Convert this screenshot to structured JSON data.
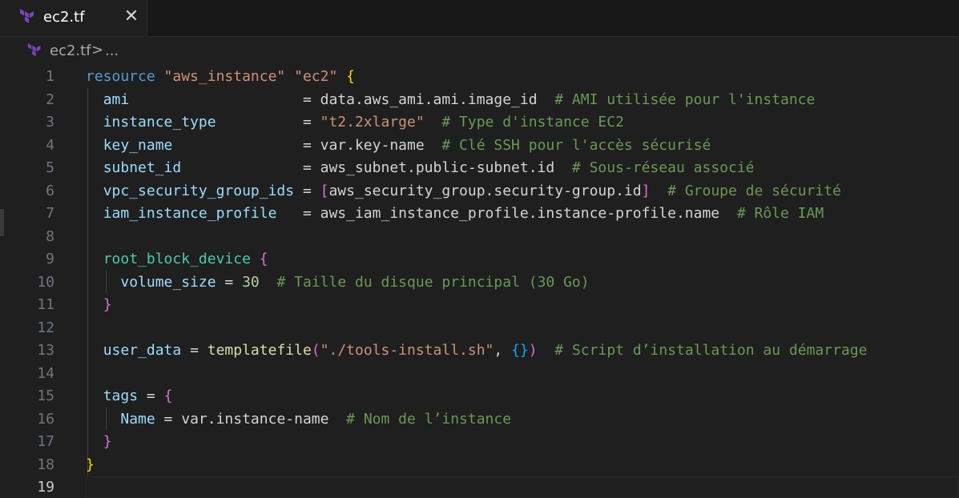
{
  "tab": {
    "label": "ec2.tf",
    "close_glyph": "✕"
  },
  "breadcrumb": {
    "file": "ec2.tf",
    "separator": ">",
    "more": "..."
  },
  "editor": {
    "active_line": 19,
    "lines": [
      {
        "n": "1",
        "tokens": [
          [
            "kw",
            "resource"
          ],
          [
            "op",
            " "
          ],
          [
            "str",
            "\"aws_instance\""
          ],
          [
            "op",
            " "
          ],
          [
            "str",
            "\"ec2\""
          ],
          [
            "op",
            " "
          ],
          [
            "brace-y",
            "{"
          ]
        ]
      },
      {
        "n": "2",
        "tokens": [
          [
            "op",
            "  "
          ],
          [
            "attr",
            "ami"
          ],
          [
            "op",
            "                    = "
          ],
          [
            "op",
            "data.aws_ami.ami.image_id"
          ],
          [
            "op",
            "  "
          ],
          [
            "cmt",
            "# AMI utilisée pour l'instance"
          ]
        ]
      },
      {
        "n": "3",
        "tokens": [
          [
            "op",
            "  "
          ],
          [
            "attr",
            "instance_type"
          ],
          [
            "op",
            "          = "
          ],
          [
            "str",
            "\"t2.2xlarge\""
          ],
          [
            "op",
            "  "
          ],
          [
            "cmt",
            "# Type d'instance EC2"
          ]
        ]
      },
      {
        "n": "4",
        "tokens": [
          [
            "op",
            "  "
          ],
          [
            "attr",
            "key_name"
          ],
          [
            "op",
            "               = "
          ],
          [
            "op",
            "var.key-name"
          ],
          [
            "op",
            "  "
          ],
          [
            "cmt",
            "# Clé SSH pour l'accès sécurisé"
          ]
        ]
      },
      {
        "n": "5",
        "tokens": [
          [
            "op",
            "  "
          ],
          [
            "attr",
            "subnet_id"
          ],
          [
            "op",
            "              = "
          ],
          [
            "op",
            "aws_subnet.public-subnet.id"
          ],
          [
            "op",
            "  "
          ],
          [
            "cmt",
            "# Sous-réseau associé"
          ]
        ]
      },
      {
        "n": "6",
        "tokens": [
          [
            "op",
            "  "
          ],
          [
            "attr",
            "vpc_security_group_ids"
          ],
          [
            "op",
            " = "
          ],
          [
            "brace-p",
            "["
          ],
          [
            "op",
            "aws_security_group.security-group.id"
          ],
          [
            "brace-p",
            "]"
          ],
          [
            "op",
            "  "
          ],
          [
            "cmt",
            "# Groupe de sécurité"
          ]
        ]
      },
      {
        "n": "7",
        "tokens": [
          [
            "op",
            "  "
          ],
          [
            "attr",
            "iam_instance_profile"
          ],
          [
            "op",
            "   = "
          ],
          [
            "op",
            "aws_iam_instance_profile.instance-profile.name"
          ],
          [
            "op",
            "  "
          ],
          [
            "cmt",
            "# Rôle IAM"
          ]
        ]
      },
      {
        "n": "8",
        "tokens": []
      },
      {
        "n": "9",
        "tokens": [
          [
            "op",
            "  "
          ],
          [
            "blk",
            "root_block_device"
          ],
          [
            "op",
            " "
          ],
          [
            "brace-p",
            "{"
          ]
        ]
      },
      {
        "n": "10",
        "tokens": [
          [
            "op",
            "    "
          ],
          [
            "attr",
            "volume_size"
          ],
          [
            "op",
            " = "
          ],
          [
            "num",
            "30"
          ],
          [
            "op",
            "  "
          ],
          [
            "cmt",
            "# Taille du disque principal (30 Go)"
          ]
        ]
      },
      {
        "n": "11",
        "tokens": [
          [
            "op",
            "  "
          ],
          [
            "brace-p",
            "}"
          ]
        ]
      },
      {
        "n": "12",
        "tokens": []
      },
      {
        "n": "13",
        "tokens": [
          [
            "op",
            "  "
          ],
          [
            "attr",
            "user_data"
          ],
          [
            "op",
            " = "
          ],
          [
            "fn",
            "templatefile"
          ],
          [
            "brace-p",
            "("
          ],
          [
            "str",
            "\"./tools-install.sh\""
          ],
          [
            "op",
            ", "
          ],
          [
            "brace-b",
            "{}"
          ],
          [
            "brace-p",
            ")"
          ],
          [
            "op",
            "  "
          ],
          [
            "cmt",
            "# Script d’installation au démarrage"
          ]
        ]
      },
      {
        "n": "14",
        "tokens": []
      },
      {
        "n": "15",
        "tokens": [
          [
            "op",
            "  "
          ],
          [
            "attr",
            "tags"
          ],
          [
            "op",
            " = "
          ],
          [
            "brace-p",
            "{"
          ]
        ]
      },
      {
        "n": "16",
        "tokens": [
          [
            "op",
            "    "
          ],
          [
            "attr",
            "Name"
          ],
          [
            "op",
            " = "
          ],
          [
            "op",
            "var.instance-name"
          ],
          [
            "op",
            "  "
          ],
          [
            "cmt",
            "# Nom de l’instance"
          ]
        ]
      },
      {
        "n": "17",
        "tokens": [
          [
            "op",
            "  "
          ],
          [
            "brace-p",
            "}"
          ]
        ]
      },
      {
        "n": "18",
        "tokens": [
          [
            "brace-y",
            "}"
          ]
        ]
      },
      {
        "n": "19",
        "tokens": []
      }
    ]
  }
}
